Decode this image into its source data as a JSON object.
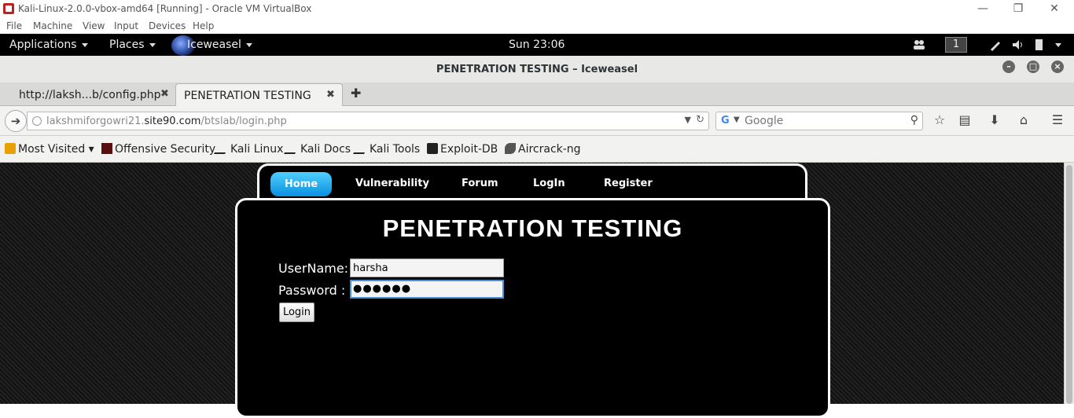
{
  "vbox": {
    "title": "Kali-Linux-2.0.0-vbox-amd64 [Running] - Oracle VM VirtualBox",
    "menu": [
      "File",
      "Machine",
      "View",
      "Input",
      "Devices",
      "Help"
    ]
  },
  "panel": {
    "applications": "Applications",
    "places": "Places",
    "app_name": "Iceweasel",
    "clock": "Sun 23:06",
    "workspace": "1"
  },
  "browser": {
    "window_title": "PENETRATION TESTING – Iceweasel",
    "tabs": [
      {
        "label": "http://laksh...b/config.php"
      },
      {
        "label": "PENETRATION TESTING"
      }
    ],
    "url_host": "lakshmiforgowri21.",
    "url_domain": "site90.com",
    "url_path": "/btslab/login.php",
    "search_placeholder": "Google",
    "bookmarks": [
      "Most Visited",
      "Offensive Security",
      "Kali Linux",
      "Kali Docs",
      "Kali Tools",
      "Exploit-DB",
      "Aircrack-ng"
    ]
  },
  "site": {
    "nav": [
      "Home",
      "Vulnerability",
      "Forum",
      "LogIn",
      "Register"
    ],
    "title": "PENETRATION TESTING",
    "username_label": "UserName:",
    "password_label": "Password :",
    "username_value": "harsha",
    "password_value": "●●●●●●",
    "login_label": "Login"
  },
  "colors": {
    "nav_active": "#0a8fe0",
    "page_bg": "#1a1a1a",
    "panel_bg": "#000000"
  }
}
